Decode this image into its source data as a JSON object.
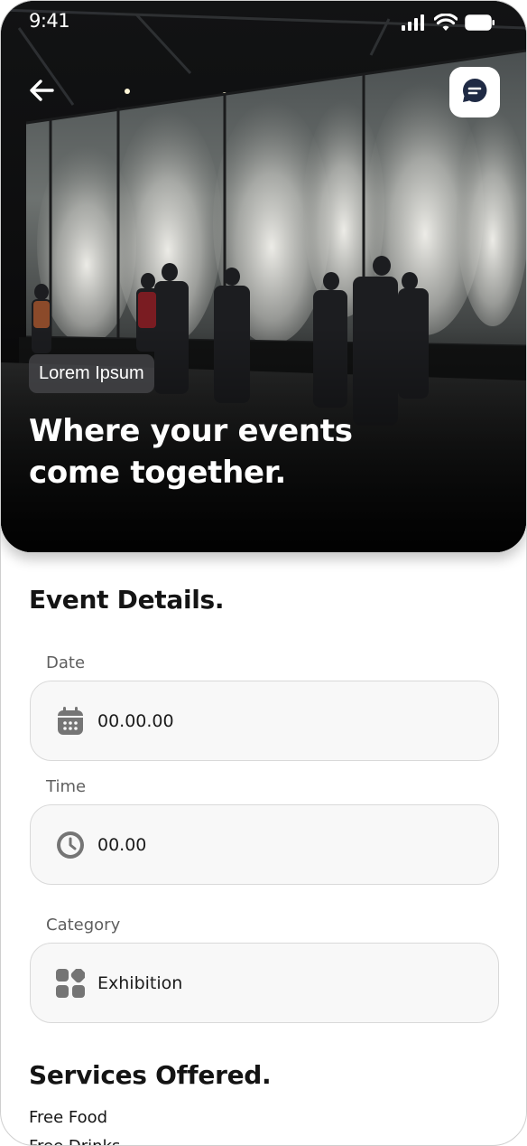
{
  "status_bar": {
    "time": "9:41",
    "icons": [
      "signal-icon",
      "wifi-icon",
      "battery-icon"
    ]
  },
  "hero": {
    "badge": "Lorem Ipsum",
    "title": "Where your events come together.",
    "back_icon": "arrow-left-icon",
    "chat_icon": "chat-bubble-icon"
  },
  "event_details": {
    "title": "Event Details.",
    "fields": [
      {
        "label": "Date",
        "value": "00.00.00",
        "icon": "calendar-icon"
      },
      {
        "label": "Time",
        "value": "00.00",
        "icon": "clock-icon"
      },
      {
        "label": "Category",
        "value": "Exhibition",
        "icon": "category-grid-icon"
      }
    ]
  },
  "services": {
    "title": "Services Offered.",
    "items": [
      "Free Food",
      "Free Drinks"
    ]
  },
  "colors": {
    "accent": "#1f2a44",
    "field_bg": "#f8f8f8",
    "field_border": "#d9d9d9",
    "icon_gray": "#757575"
  }
}
